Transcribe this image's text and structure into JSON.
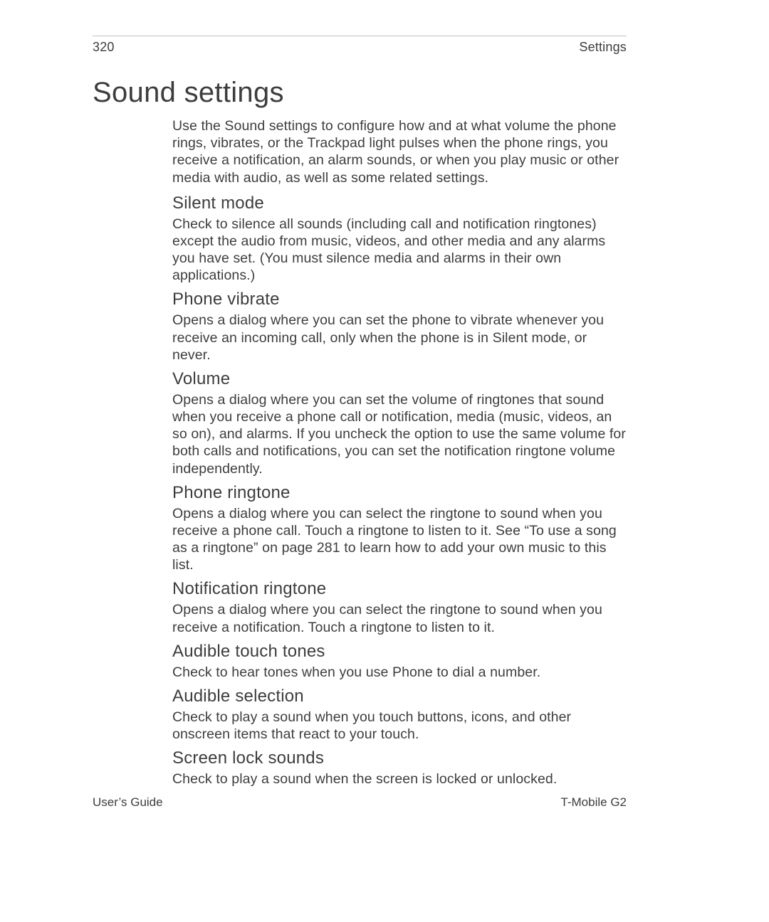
{
  "header": {
    "page_number": "320",
    "section": "Settings"
  },
  "title": "Sound settings",
  "intro": "Use the Sound settings to configure how and at what volume the phone rings, vibrates, or the Trackpad light pulses when the phone rings, you receive a notification, an alarm sounds, or when you play music or other media with audio, as well as some related settings.",
  "sections": [
    {
      "heading": "Silent mode",
      "body": "Check to silence all sounds (including call and notification ringtones) except the audio from music, videos, and other media and any alarms you have set. (You must silence media and alarms in their own applications.)"
    },
    {
      "heading": "Phone vibrate",
      "body": "Opens a dialog where you can set the phone to vibrate whenever you receive an incoming call, only when the phone is in Silent mode, or never."
    },
    {
      "heading": "Volume",
      "body": "Opens a dialog where you can set the volume of ringtones that sound when you receive a phone call or notification, media (music, videos, an so on), and alarms. If you uncheck the option to use the same volume for both calls and notifications, you can set the notification ringtone volume independently."
    },
    {
      "heading": "Phone ringtone",
      "body": "Opens a dialog where you can select the ringtone to sound when you receive a phone call. Touch a ringtone to listen to it. See “To use a song as a ringtone” on page 281 to learn how to add your own music to this list."
    },
    {
      "heading": "Notification ringtone",
      "body": "Opens a dialog where you can select the ringtone to sound when you receive a notification. Touch a ringtone to listen to it."
    },
    {
      "heading": "Audible touch tones",
      "body": "Check to hear tones when you use Phone to dial a number."
    },
    {
      "heading": "Audible selection",
      "body": "Check to play a sound when you touch buttons, icons, and other onscreen items that react to your touch."
    },
    {
      "heading": "Screen lock sounds",
      "body": "Check to play a sound when the screen is locked or unlocked."
    }
  ],
  "footer": {
    "left": "User’s Guide",
    "right": "T-Mobile G2"
  }
}
